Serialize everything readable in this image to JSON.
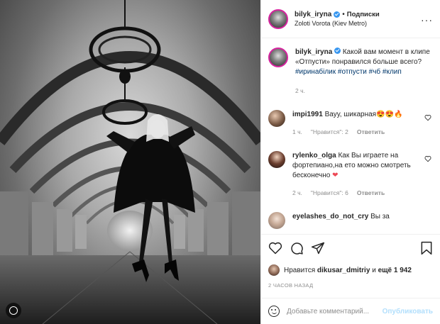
{
  "header": {
    "username": "bilyk_iryna",
    "separator": "•",
    "follow_label": "Подписки",
    "location": "Zoloti Vorota (Kiev Metro)",
    "more_label": "···"
  },
  "caption": {
    "username": "bilyk_iryna",
    "text": "Какой вам момент в клипе «Отпусти» понравился больше всего?",
    "hashtags": "#иринабілик #отпусти #чб #клип",
    "time": "2 ч."
  },
  "comments": [
    {
      "username": "impi1991",
      "text": "Вауу, шикарная😍😍🔥",
      "time": "1 ч.",
      "likes": "\"Нравится\": 2",
      "reply": "Ответить"
    },
    {
      "username": "rylenko_olga",
      "text": "Как Вы играете на фортепиано,на ето можно смотреть бесконечно",
      "heart": "❤",
      "time": "2 ч.",
      "likes": "\"Нравится\": 6",
      "reply": "Ответить"
    },
    {
      "username": "eyelashes_do_not_cry",
      "text": "Вы за"
    }
  ],
  "likes": {
    "prefix": "Нравится",
    "user": "dikusar_dmitriy",
    "conj": "и",
    "more": "ещё 1 942"
  },
  "post_time": "2 ЧАСОВ НАЗАД",
  "add_comment": {
    "placeholder": "Добавьте комментарий...",
    "publish": "Опубликовать"
  }
}
